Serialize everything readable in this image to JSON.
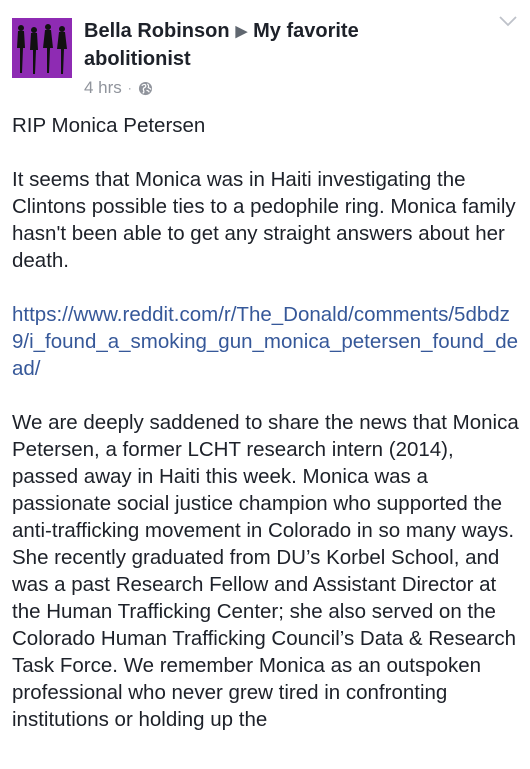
{
  "post": {
    "author": "Bella Robinson",
    "target": "My favorite abolitionist",
    "time": "4 hrs",
    "separator": "·",
    "privacy_icon": "globe-icon",
    "menu_icon": "chevron-down-icon",
    "paragraphs": [
      "RIP Monica Petersen",
      "It seems that Monica was in Haiti investigating the Clintons possible ties to a pedophile ring.  Monica family hasn't been able to get any straight answers about her death."
    ],
    "link": "https://www.reddit.com/r/The_Donald/comments/5dbdz9/i_found_a_smoking_gun_monica_petersen_found_dead/",
    "quote": "We are deeply saddened to share the news that Monica Petersen, a former LCHT research intern (2014), passed away in Haiti this week. Monica was a passionate social justice champion who supported the anti-trafficking movement in Colorado in so many ways. She recently graduated from DU’s Korbel School, and was a past Research Fellow and Assistant Director at the Human Trafficking Center; she also served on the Colorado Human Trafficking Council’s Data & Research Task Force. We remember Monica as an outspoken professional who never grew tired in confronting institutions or holding up the"
  },
  "colors": {
    "text": "#1d2129",
    "link": "#365899",
    "meta": "#90949c",
    "avatar_bg": "#8e2bb3"
  }
}
